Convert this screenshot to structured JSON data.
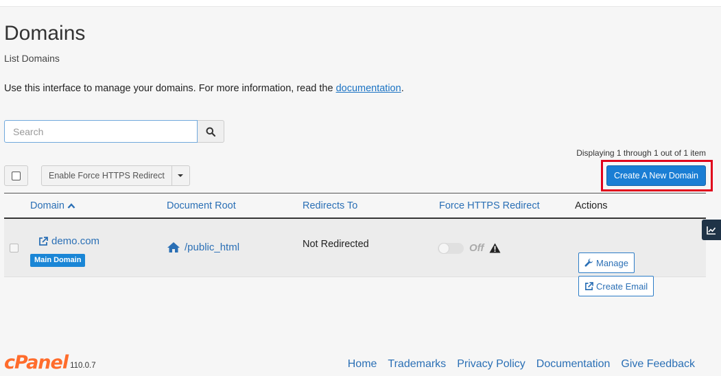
{
  "header": {
    "title": "Domains",
    "subtitle": "List Domains",
    "intro_text": "Use this interface to manage your domains. For more information, read the ",
    "intro_link": "documentation",
    "intro_end": "."
  },
  "search": {
    "placeholder": "Search",
    "value": ""
  },
  "pagination": {
    "displaying": "Displaying 1 through 1 out of 1 item"
  },
  "toolbar": {
    "bulk_action_label": "Enable Force HTTPS Redirect",
    "create_label": "Create A New Domain"
  },
  "table": {
    "columns": [
      "Domain",
      "Document Root",
      "Redirects To",
      "Force HTTPS Redirect",
      "Actions"
    ],
    "sort_icon": "chevron-up-icon",
    "rows": [
      {
        "domain": "demo.com",
        "badge": "Main Domain",
        "document_root": "/public_html",
        "redirects_to": "Not Redirected",
        "https_state": "Off",
        "actions": {
          "manage": "Manage",
          "create_email": "Create Email"
        }
      }
    ]
  },
  "footer": {
    "logo": "cPanel",
    "version": "110.0.7",
    "links": [
      "Home",
      "Trademarks",
      "Privacy Policy",
      "Documentation",
      "Give Feedback"
    ]
  },
  "colors": {
    "accent": "#1a7ed4",
    "link": "#2a6fb5",
    "highlight": "#e0001b",
    "logo": "#ff6c2c"
  }
}
